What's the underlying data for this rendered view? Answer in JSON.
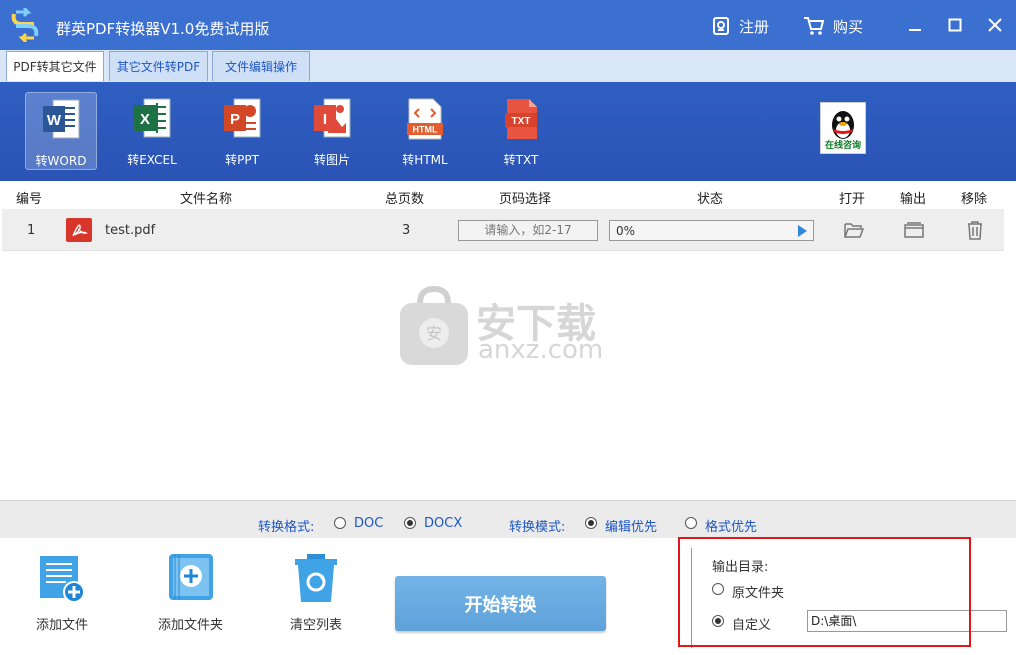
{
  "app": {
    "title": "群英PDF转换器V1.0免费试用版"
  },
  "titlebar": {
    "register_label": "注册",
    "buy_label": "购买"
  },
  "tabs": [
    {
      "label": "PDF转其它文件"
    },
    {
      "label": "其它文件转PDF"
    },
    {
      "label": "文件编辑操作"
    }
  ],
  "tools": [
    {
      "label": "转WORD",
      "icon": "word-icon",
      "color": "#2b5797"
    },
    {
      "label": "转EXCEL",
      "icon": "excel-icon",
      "color": "#1e7145"
    },
    {
      "label": "转PPT",
      "icon": "ppt-icon",
      "color": "#d24726"
    },
    {
      "label": "转图片",
      "icon": "image-icon",
      "color": "#e04a3a"
    },
    {
      "label": "转HTML",
      "icon": "html-icon",
      "color": "#e35d2f"
    },
    {
      "label": "转TXT",
      "icon": "txt-icon",
      "color": "#e8543f"
    }
  ],
  "qq": {
    "label": "在线咨询"
  },
  "table": {
    "headers": {
      "index": "编号",
      "name": "文件名称",
      "pages": "总页数",
      "page_select": "页码选择",
      "status": "状态",
      "open": "打开",
      "output": "输出",
      "remove": "移除"
    },
    "rows": [
      {
        "index": "1",
        "name": "test.pdf",
        "pages": "3",
        "page_placeholder": "请输入，如2-17",
        "progress_text": "0%",
        "progress": 0
      }
    ]
  },
  "watermark": {
    "text": "安下载",
    "sub": "anxz.com"
  },
  "options": {
    "format_label": "转换格式:",
    "format_options": [
      "DOC",
      "DOCX"
    ],
    "format_selected": "DOCX",
    "mode_label": "转换模式:",
    "mode_options": [
      "编辑优先",
      "格式优先"
    ],
    "mode_selected": "编辑优先"
  },
  "bottom": {
    "add_file": "添加文件",
    "add_folder": "添加文件夹",
    "clear_list": "清空列表",
    "start": "开始转换"
  },
  "output_dir": {
    "title": "输出目录:",
    "option_original": "原文件夹",
    "option_custom": "自定义",
    "selected": "自定义",
    "path": "D:\\桌面\\"
  },
  "colors": {
    "titlebar": "#3b6fd0",
    "accent_blue": "#1e57c4",
    "highlight_red": "#e01818",
    "start_button": "#5ea2da"
  }
}
